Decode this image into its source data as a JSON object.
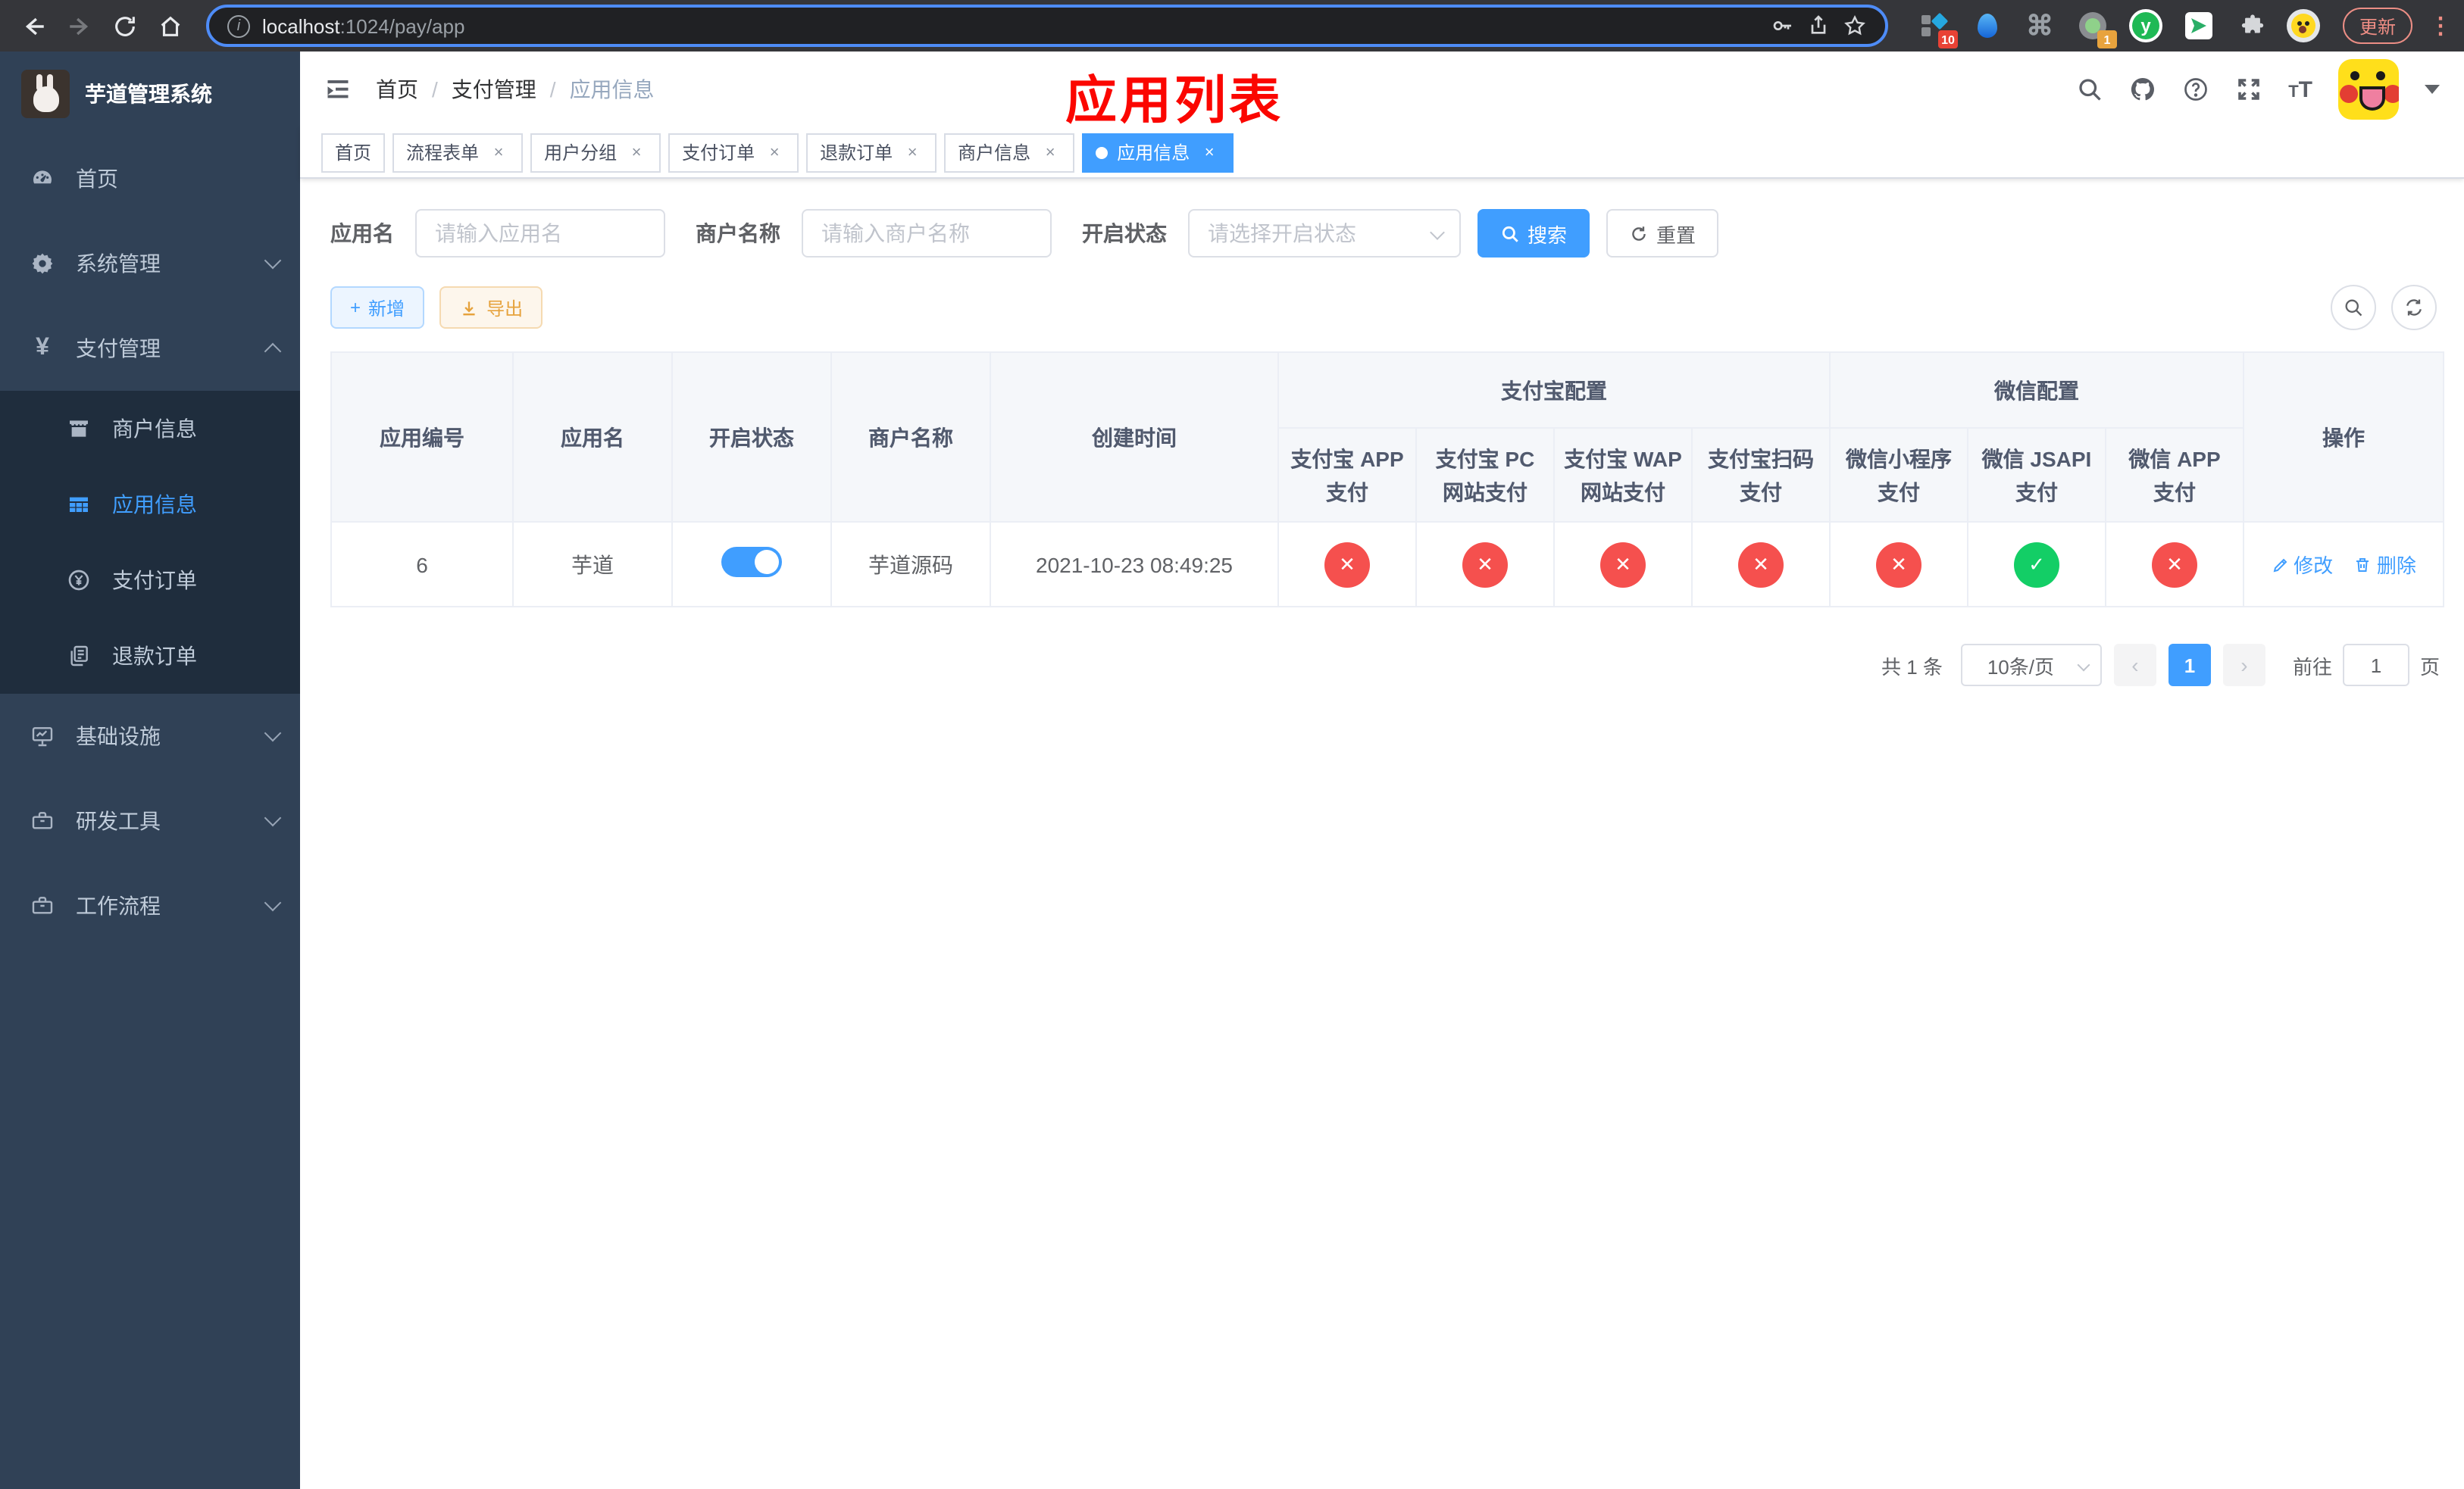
{
  "colors": {
    "accent": "#409eff",
    "danger": "#f5504e",
    "success": "#13ce66",
    "warning": "#e6a23c",
    "sidebar": "#304156",
    "submenu": "#1f2d3d"
  },
  "browser": {
    "url_host": "localhost",
    "url_rest": ":1024/pay/app",
    "update_label": "更新",
    "ext_badge_a": "10",
    "ext_badge_b": "1",
    "ext_y_letter": "y",
    "cmd_glyph": "⌘"
  },
  "sidebar": {
    "title": "芋道管理系统",
    "home": "首页",
    "system": "系统管理",
    "payment": "支付管理",
    "merchant_info": "商户信息",
    "app_info": "应用信息",
    "pay_order": "支付订单",
    "refund_order": "退款订单",
    "infra": "基础设施",
    "devtools": "研发工具",
    "workflow": "工作流程",
    "yen": "¥"
  },
  "navbar": {
    "breadcrumb": {
      "home": "首页",
      "section": "支付管理",
      "current": "应用信息"
    },
    "separator": "/",
    "font_size_icon": "T"
  },
  "annotation": "应用列表",
  "tags": [
    {
      "label": "首页"
    },
    {
      "label": "流程表单",
      "close": "×"
    },
    {
      "label": "用户分组",
      "close": "×"
    },
    {
      "label": "支付订单",
      "close": "×"
    },
    {
      "label": "退款订单",
      "close": "×"
    },
    {
      "label": "商户信息",
      "close": "×"
    },
    {
      "label": "应用信息",
      "close": "×"
    }
  ],
  "filters": {
    "app_name": {
      "label": "应用名",
      "placeholder": "请输入应用名"
    },
    "merchant_name": {
      "label": "商户名称",
      "placeholder": "请输入商户名称"
    },
    "status": {
      "label": "开启状态",
      "placeholder": "请选择开启状态"
    },
    "search": "搜索",
    "reset": "重置"
  },
  "toolbar": {
    "add_icon": "+",
    "add": "新增",
    "export": "导出"
  },
  "table": {
    "headers": {
      "app_id": "应用编号",
      "app_name": "应用名",
      "status": "开启状态",
      "merchant": "商户名称",
      "created": "创建时间",
      "alipay_group": "支付宝配置",
      "wechat_group": "微信配置",
      "alipay_app": "支付宝 APP 支付",
      "alipay_pc": "支付宝 PC 网站支付",
      "alipay_wap": "支付宝 WAP 网站支付",
      "alipay_qr": "支付宝扫码支付",
      "wx_mini": "微信小程序支付",
      "wx_jsapi": "微信 JSAPI 支付",
      "wx_app": "微信 APP 支付",
      "actions": "操作"
    },
    "row": {
      "id": "6",
      "name": "芋道",
      "switch_cls": "el-switch on",
      "merchant": "芋道源码",
      "created": "2021-10-23 08:49:25",
      "statuses": [
        {
          "glyph": "✕",
          "cls": "status-circle cross"
        },
        {
          "glyph": "✕",
          "cls": "status-circle cross"
        },
        {
          "glyph": "✕",
          "cls": "status-circle cross"
        },
        {
          "glyph": "✕",
          "cls": "status-circle cross"
        },
        {
          "glyph": "✕",
          "cls": "status-circle cross"
        },
        {
          "glyph": "✓",
          "cls": "status-circle check"
        },
        {
          "glyph": "✕",
          "cls": "status-circle cross"
        }
      ],
      "edit": "修改",
      "delete": "删除"
    }
  },
  "pagination": {
    "total": "共 1 条",
    "page_size": "10条/页",
    "prev": "‹",
    "page": "1",
    "next": "›",
    "goto_label": "前往",
    "goto_value": "1",
    "unit": "页"
  }
}
